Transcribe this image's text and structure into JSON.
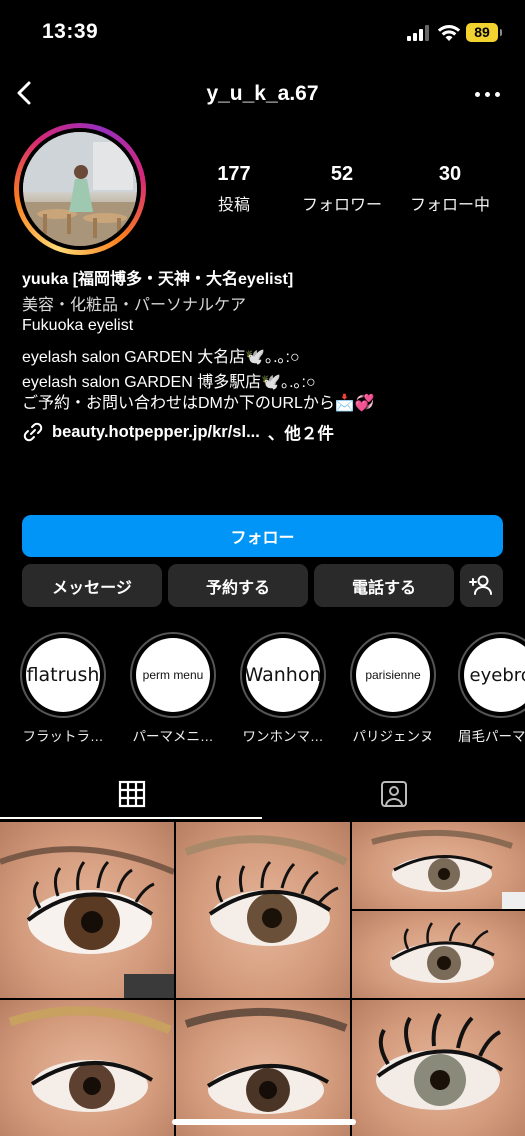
{
  "status_bar": {
    "time": "13:39",
    "battery": "89"
  },
  "header": {
    "username": "y_u_k_a.67"
  },
  "stats": [
    {
      "number": "177",
      "label": "投稿"
    },
    {
      "number": "52",
      "label": "フォロワー"
    },
    {
      "number": "30",
      "label": "フォロー中"
    }
  ],
  "bio": {
    "name": "yuuka [福岡博多・天神・大名eyelist]",
    "category": "美容・化粧品・パーソナルケア",
    "lines": [
      "Fukuoka eyelist",
      "eyelash salon GARDEN 大名店🕊️｡.｡:○",
      "eyelash salon GARDEN 博多駅店🕊️｡.｡:○",
      "ご予約・お問い合わせはDMか下のURLから📩💞"
    ],
    "link": "beauty.hotpepper.jp/kr/sl...",
    "link_suffix": "、他２件"
  },
  "buttons": {
    "follow": "フォロー",
    "message": "メッセージ",
    "reserve": "予約する",
    "call": "電話する"
  },
  "highlights": [
    {
      "cover_text": "flatrush",
      "label": "フラットラ…"
    },
    {
      "cover_text": "perm menu",
      "label": "パーマメニ…"
    },
    {
      "cover_text": "Wanhon",
      "label": "ワンホンマ…"
    },
    {
      "cover_text": "parisienne",
      "label": "パリジェンヌ"
    },
    {
      "cover_text": "eyebrow",
      "label": "眉毛パーマ"
    }
  ],
  "colors": {
    "accent": "#0095f6",
    "button_bg": "#2a2a2a",
    "battery": "#f2d22e"
  },
  "icons": [
    "back-arrow-icon",
    "more-icon",
    "link-icon",
    "add-person-icon",
    "grid-icon",
    "tagged-icon"
  ]
}
